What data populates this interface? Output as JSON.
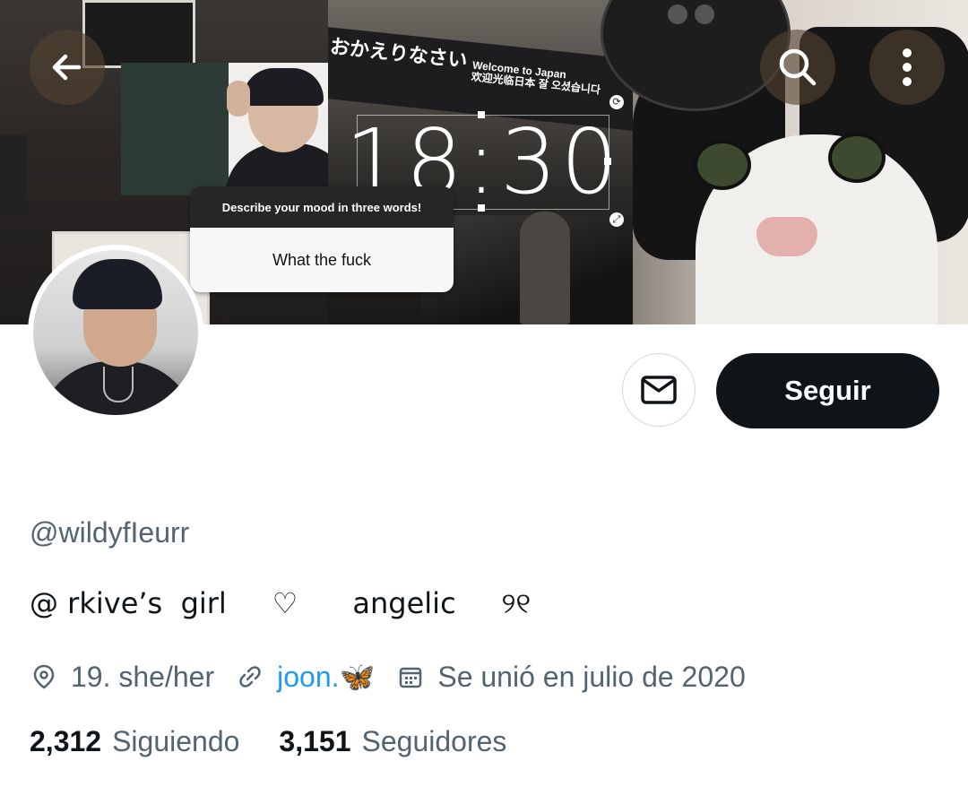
{
  "header": {
    "back_icon": "arrow-left-icon",
    "search_icon": "search-icon",
    "more_icon": "more-vertical-icon"
  },
  "banner": {
    "japanese_greeting": "おかえりなさい",
    "welcome_line1": "Welcome to Japan",
    "welcome_line2": "欢迎光临日本  잘 오셨습니다",
    "clock_time": "18:30",
    "mood_question": "Describe your mood in three words!",
    "mood_answer": "What the fuck"
  },
  "profile": {
    "handle": "@wildyfIeurr",
    "bio": "@ rkive’s  girl     ♡      angelic     ୨୧",
    "location": "19. she/her",
    "link_text": "joon.🦋",
    "joined": "Se unió en julio de 2020",
    "following_count": "2,312",
    "following_label": "Siguiendo",
    "followers_count": "3,151",
    "followers_label": "Seguidores"
  },
  "actions": {
    "message_icon": "envelope-icon",
    "follow_label": "Seguir"
  },
  "colors": {
    "primary_text": "#0f1419",
    "secondary_text": "#536471",
    "link": "#1d9bf0",
    "follow_button": "#0f1419"
  }
}
